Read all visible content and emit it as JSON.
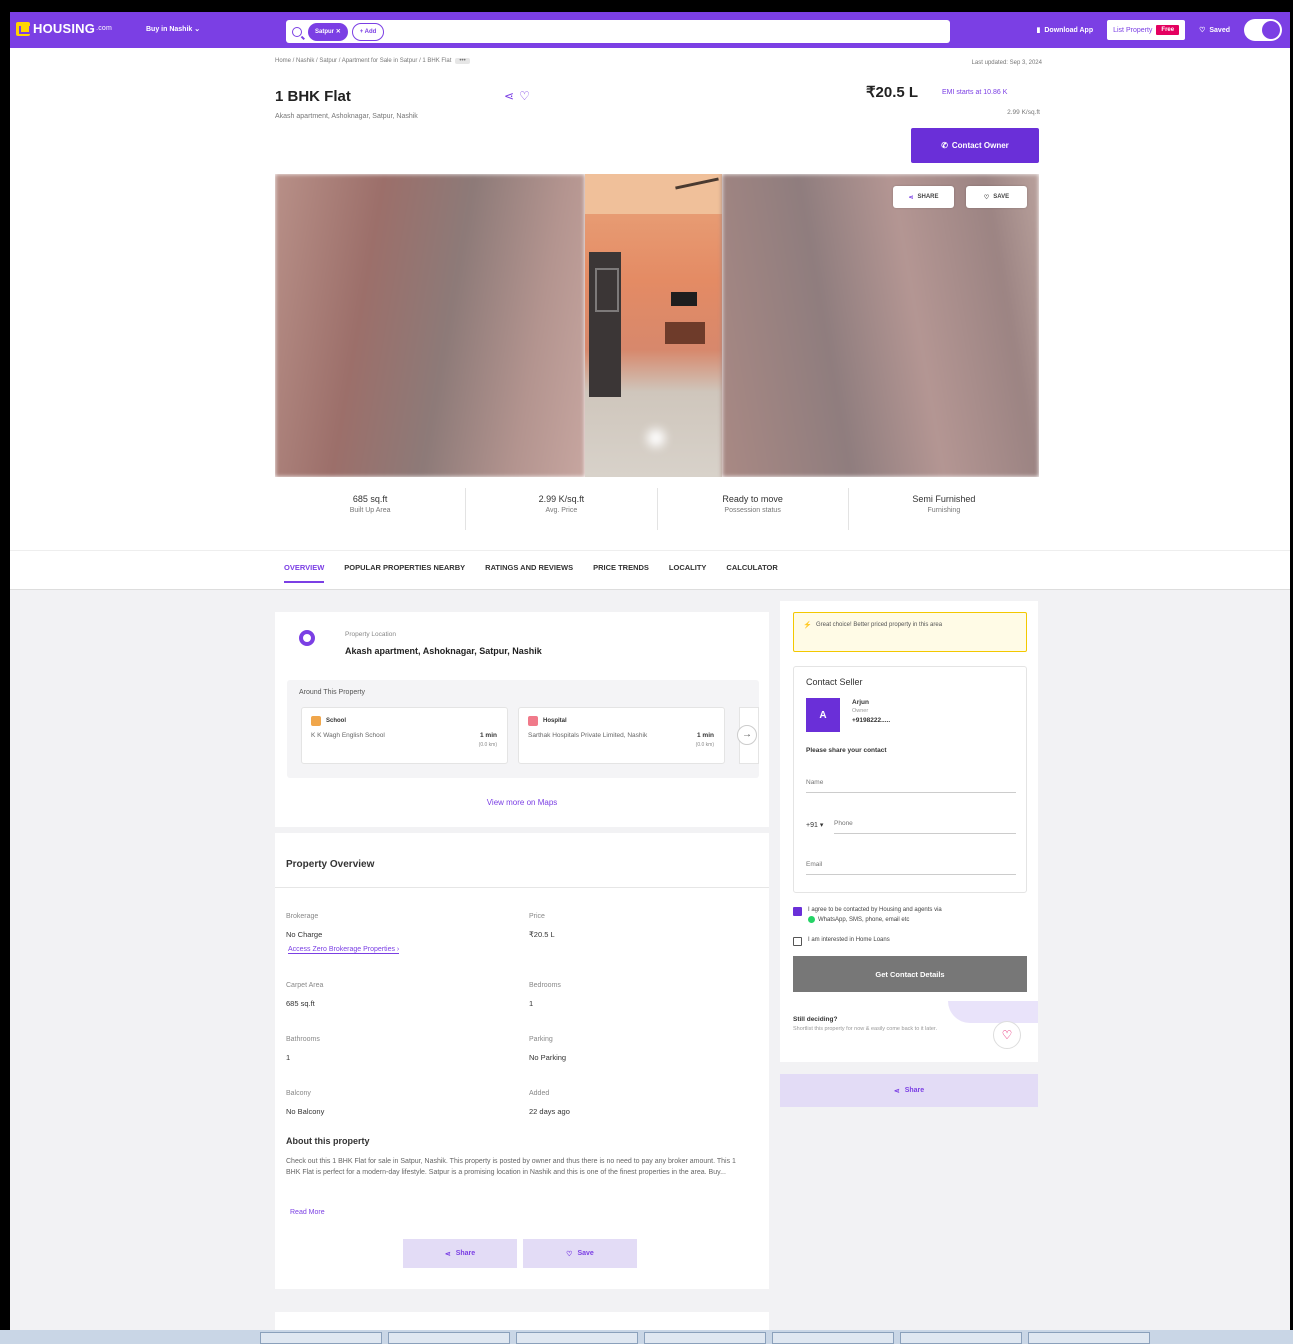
{
  "nav": {
    "logo_text": "HOUSING",
    "logo_suffix": ".com",
    "buy_dropdown": "Buy in Nashik",
    "search_chip": "Satpur",
    "add_chip": "+ Add",
    "download_app": "Download App",
    "list_property": "List Property",
    "list_badge": "Free",
    "saved": "Saved"
  },
  "header": {
    "breadcrumb": "Home / Nashik / Satpur / Apartment for Sale in Satpur / 1 BHK Flat",
    "breadcrumb_more": "•••",
    "last_updated": "Last updated: Sep 3, 2024",
    "title": "1 BHK Flat",
    "address": "Akash apartment, Ashoknagar, Satpur, Nashik",
    "price": "₹20.5 L",
    "emi": "EMI starts at 10.86 K",
    "price_per_sqft": "2.99 K/sq.ft",
    "contact_owner": "Contact Owner"
  },
  "gallery": {
    "share_label": "SHARE",
    "save_label": "SAVE"
  },
  "stats": [
    {
      "value": "685 sq.ft",
      "label": "Built Up Area"
    },
    {
      "value": "2.99 K/sq.ft",
      "label": "Avg. Price"
    },
    {
      "value": "Ready to move",
      "label": "Possession status"
    },
    {
      "value": "Semi Furnished",
      "label": "Furnishing"
    }
  ],
  "tabs": [
    "OVERVIEW",
    "POPULAR PROPERTIES NEARBY",
    "RATINGS AND REVIEWS",
    "PRICE TRENDS",
    "LOCALITY",
    "CALCULATOR"
  ],
  "location": {
    "label": "Property Location",
    "value": "Akash apartment, Ashoknagar, Satpur, Nashik",
    "around_title": "Around This Property",
    "pois": [
      {
        "category": "School",
        "name": "K K Wagh English School",
        "time": "1 min",
        "dist": "(0.0 km)"
      },
      {
        "category": "Hospital",
        "name": "Sarthak Hospitals Private Limited, Nashik",
        "time": "1 min",
        "dist": "(0.0 km)"
      }
    ],
    "view_maps": "View more on Maps"
  },
  "overview": {
    "title": "Property Overview",
    "fields": [
      {
        "label": "Brokerage",
        "value": "No Charge"
      },
      {
        "label": "Price",
        "value": "₹20.5 L"
      },
      {
        "label": "Carpet Area",
        "value": "685 sq.ft"
      },
      {
        "label": "Bedrooms",
        "value": "1"
      },
      {
        "label": "Bathrooms",
        "value": "1"
      },
      {
        "label": "Parking",
        "value": "No Parking"
      },
      {
        "label": "Balcony",
        "value": "No Balcony"
      },
      {
        "label": "Added",
        "value": "22 days ago"
      }
    ],
    "zero_brokerage_link": "Access Zero Brokerage Properties ›",
    "about_title": "About this property",
    "about_text": "Check out this 1 BHK Flat for sale in Satpur, Nashik. This property is posted by owner and thus there is no need to pay any broker amount. This 1 BHK Flat is perfect for a modern-day lifestyle. Satpur is a promising location in Nashik and this is one of the finest properties in the area. Buy...",
    "read_more": "Read More",
    "share_label": "Share",
    "save_label": "Save"
  },
  "sidebar": {
    "great_choice": "Great choice! Better priced property in this area",
    "contact_heading": "Contact Seller",
    "seller_initial": "A",
    "seller_name": "Arjun",
    "seller_role": "Owner",
    "seller_phone": "+9198222.....",
    "share_contact": "Please share your contact",
    "name_placeholder": "Name",
    "country_code": "+91 ▾",
    "phone_placeholder": "Phone",
    "email_placeholder": "Email",
    "agree_text": "I agree to be contacted by Housing and agents via",
    "agree_channels": "WhatsApp, SMS, phone, email etc",
    "home_loans": "I am interested in Home Loans",
    "get_contact": "Get Contact Details",
    "still_deciding": "Still deciding?",
    "still_sub": "Shortlist this property for now & easily come back to it later.",
    "share_label": "Share"
  }
}
